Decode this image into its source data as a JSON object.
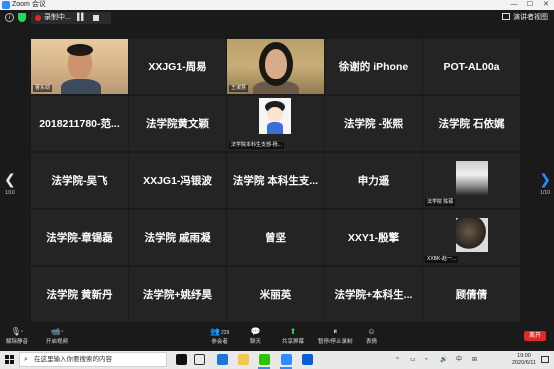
{
  "window": {
    "title": "Zoom 会议",
    "controls": [
      "—",
      "☐",
      "✕"
    ]
  },
  "topbar": {
    "recording_label": "录制中...",
    "speaker_view_label": "演讲者视图"
  },
  "gallery": {
    "page_left": "1/10",
    "page_right": "1/10",
    "tiles": [
      {
        "name": "",
        "tag": "曹东劲",
        "kind": "video-man"
      },
      {
        "name": "XXJG1-周易",
        "tag": "",
        "kind": "name"
      },
      {
        "name": "",
        "tag": "王淑慧",
        "kind": "video-woman",
        "active": true
      },
      {
        "name": "徐谢的 iPhone",
        "tag": "",
        "kind": "name"
      },
      {
        "name": "POT-AL00a",
        "tag": "",
        "kind": "name"
      },
      {
        "name": "2018211780-范...",
        "tag": "",
        "kind": "name"
      },
      {
        "name": "法学院黄文颖",
        "tag": "",
        "kind": "name"
      },
      {
        "name": "",
        "tag": "法学院本科生支部-杨...",
        "kind": "avatar-cartoon"
      },
      {
        "name": "法学院 -张熙",
        "tag": "",
        "kind": "name"
      },
      {
        "name": "法学院 石依娓",
        "tag": "",
        "kind": "name"
      },
      {
        "name": "法学院-吴飞",
        "tag": "",
        "kind": "name"
      },
      {
        "name": "XXJG1-冯银波",
        "tag": "",
        "kind": "name"
      },
      {
        "name": "法学院 本科生支...",
        "tag": "",
        "kind": "name"
      },
      {
        "name": "申力遥",
        "tag": "",
        "kind": "name"
      },
      {
        "name": "",
        "tag": "法学院 陈硕",
        "kind": "avatar-landscape"
      },
      {
        "name": "法学院-章锡磊",
        "tag": "",
        "kind": "name"
      },
      {
        "name": "法学院 戚雨凝",
        "tag": "",
        "kind": "name"
      },
      {
        "name": "曾坚",
        "tag": "",
        "kind": "name"
      },
      {
        "name": "XXY1-殷擎",
        "tag": "",
        "kind": "name"
      },
      {
        "name": "",
        "tag": "XXBK-赵一...",
        "kind": "avatar-dark"
      },
      {
        "name": "法学院 黄新丹",
        "tag": "",
        "kind": "name"
      },
      {
        "name": "法学院+姚纾昊",
        "tag": "",
        "kind": "name"
      },
      {
        "name": "米丽英",
        "tag": "",
        "kind": "name"
      },
      {
        "name": "法学院+本科生...",
        "tag": "",
        "kind": "name"
      },
      {
        "name": "顾倩倩",
        "tag": "",
        "kind": "name"
      }
    ]
  },
  "toolbar": {
    "unmute_label": "解除静音",
    "start_video_label": "开启视频",
    "participants_label": "参会者",
    "participants_count": "229",
    "chat_label": "聊天",
    "share_label": "共享屏幕",
    "pause_record_label": "暂停/停止录制",
    "reactions_label": "表情",
    "leave_label": "离开"
  },
  "taskbar": {
    "search_placeholder": "在这里输入你要搜索的内容",
    "ime": "中",
    "time": "19:00",
    "date": "2020/6/11"
  },
  "colors": {
    "zoom_blue": "#2d8cff",
    "recording_red": "#e02828",
    "active_speaker": "#c8e040",
    "share_green": "#23d959"
  }
}
